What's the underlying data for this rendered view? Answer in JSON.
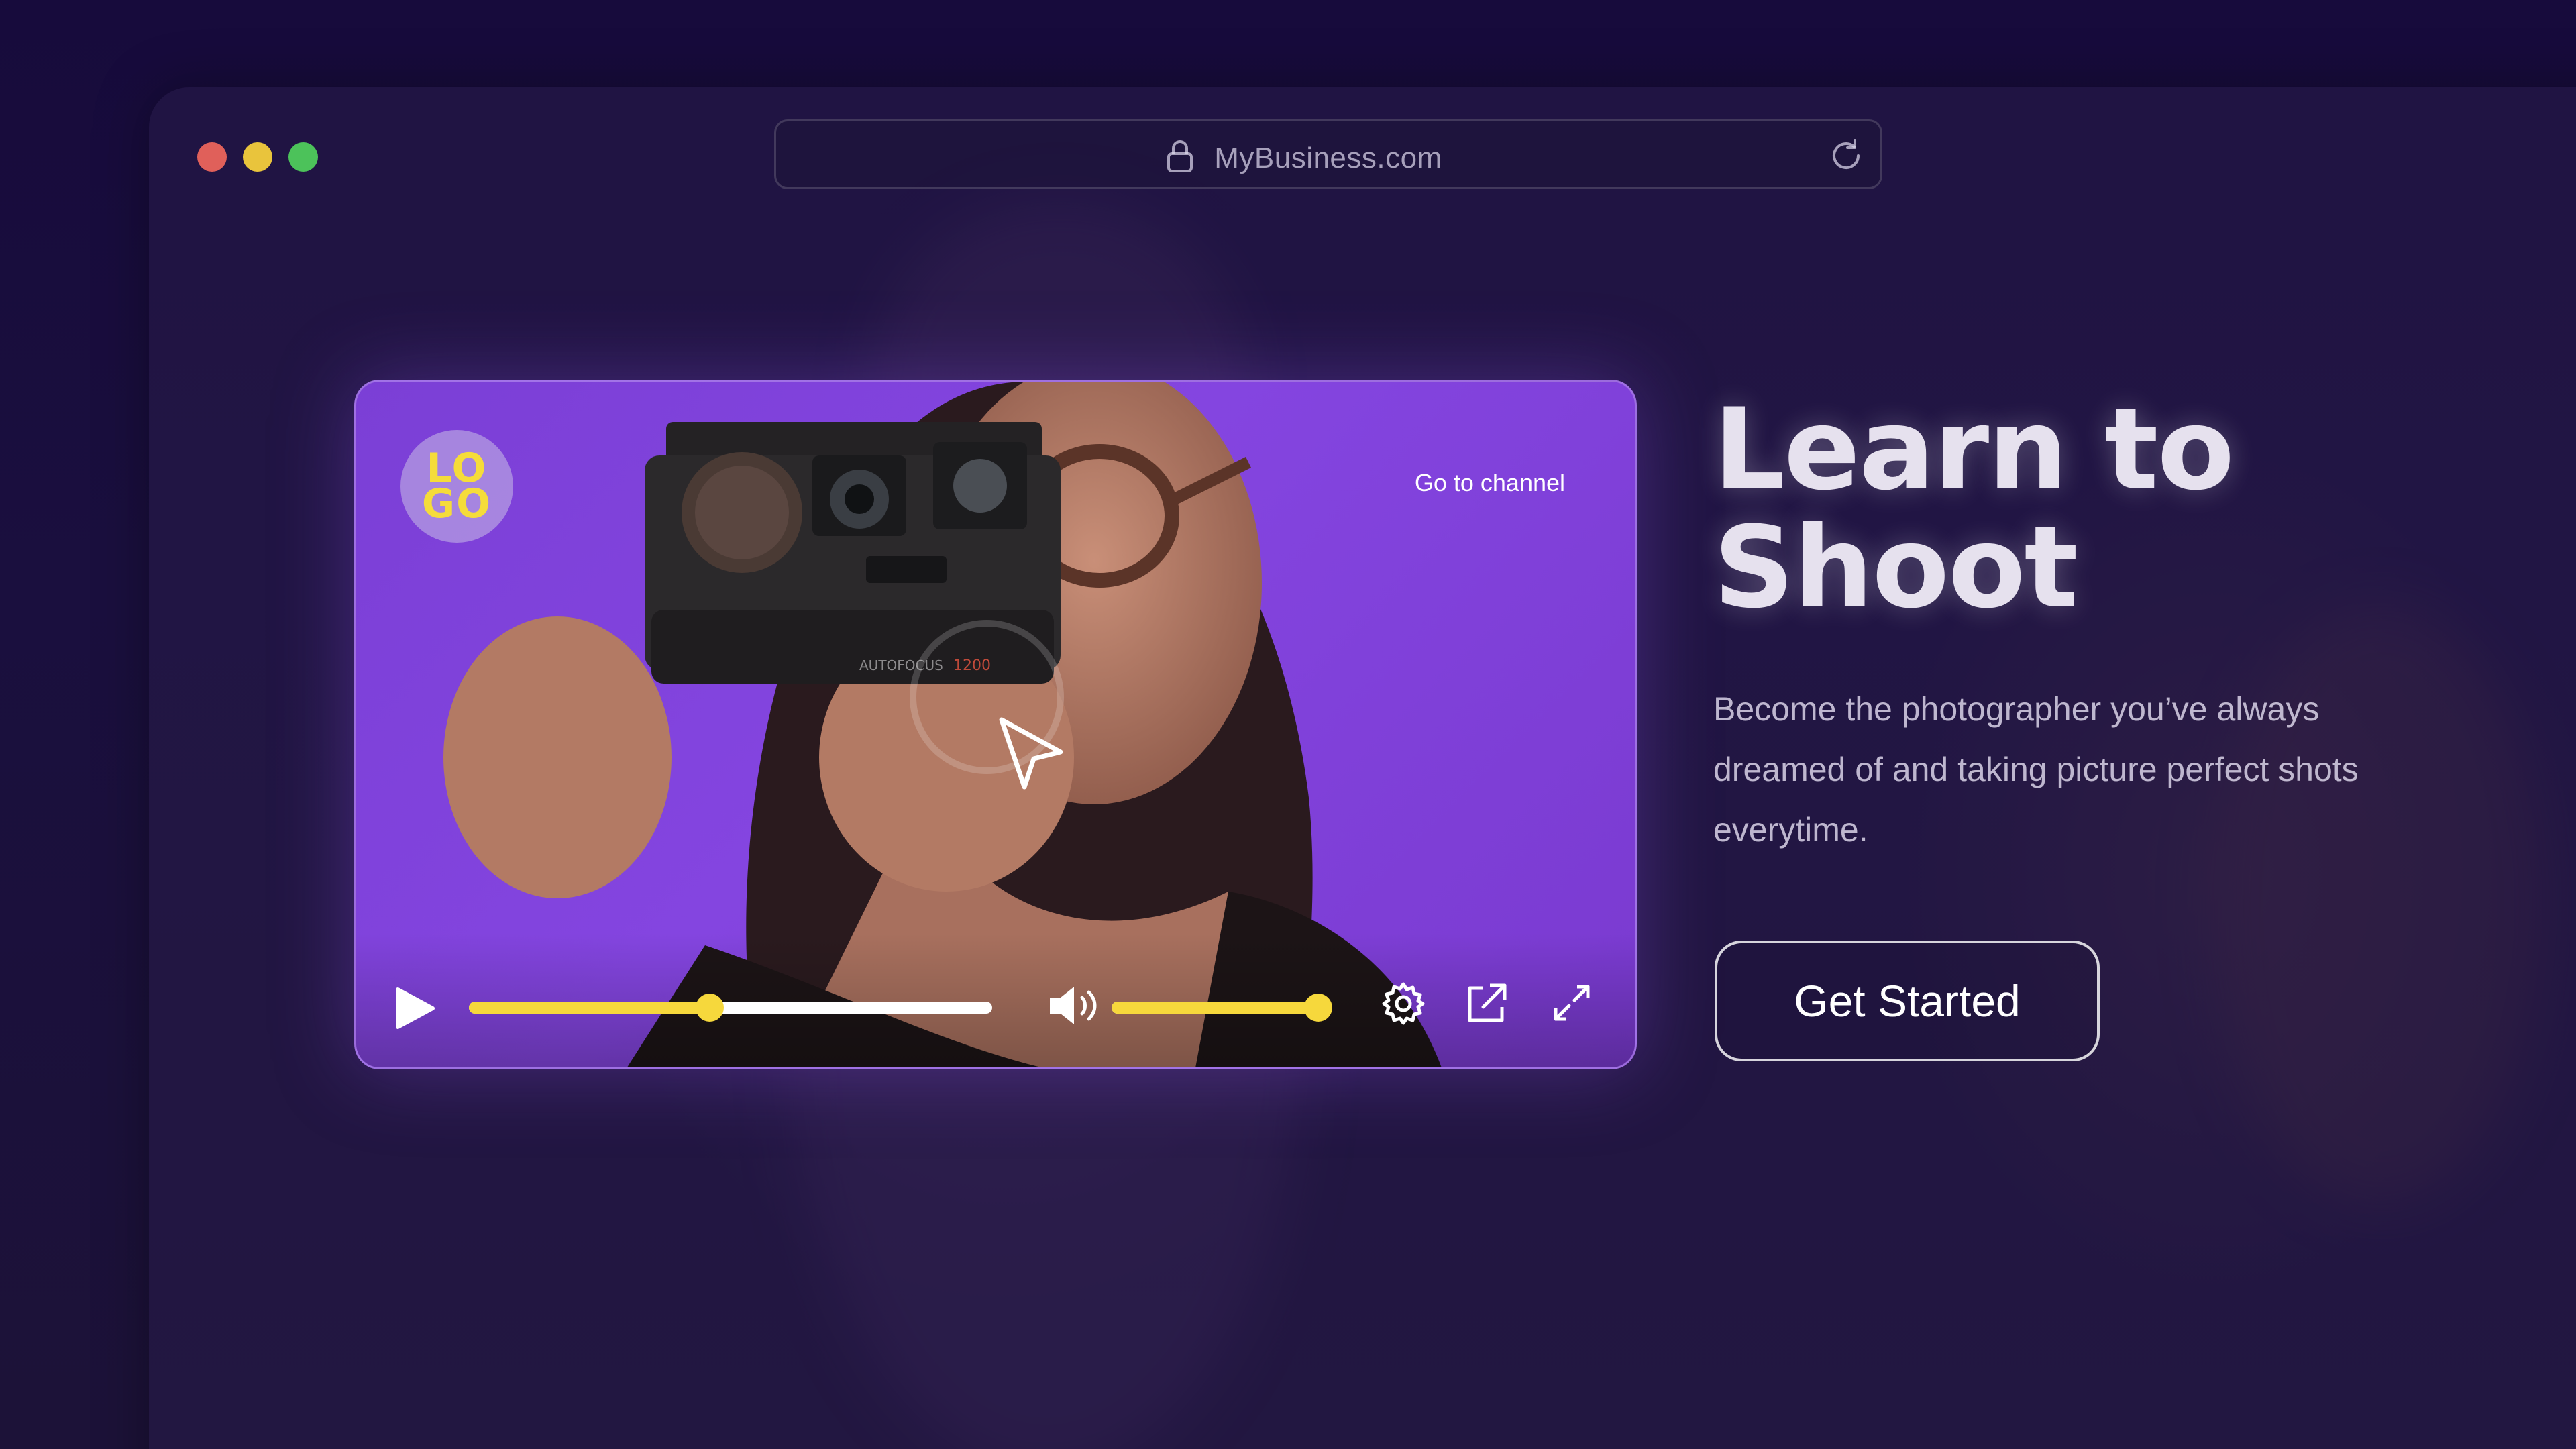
{
  "browser": {
    "url": "MyBusiness.com",
    "traffic_lights": {
      "close_color": "#e0605a",
      "minimize_color": "#e9c43c",
      "maximize_color": "#4cc25a"
    },
    "lock_icon": "lock-icon",
    "reload_icon": "reload-icon"
  },
  "player": {
    "logo_line_1": "LO",
    "logo_line_2": "GO",
    "channel_link": "Go to channel",
    "accent_color": "#f6d83c",
    "background_color": "#7b3fd6",
    "seek_progress": 0.46,
    "volume_level": 1.0,
    "icons": [
      "play-icon",
      "volume-icon",
      "gear-icon",
      "share-icon",
      "fullscreen-icon"
    ]
  },
  "hero": {
    "title_line_1": "Learn to",
    "title_line_2": "Shoot",
    "subtitle": "Become the photographer you’ve always dreamed of and taking picture perfect shots everytime.",
    "cta_label": "Get Started"
  }
}
